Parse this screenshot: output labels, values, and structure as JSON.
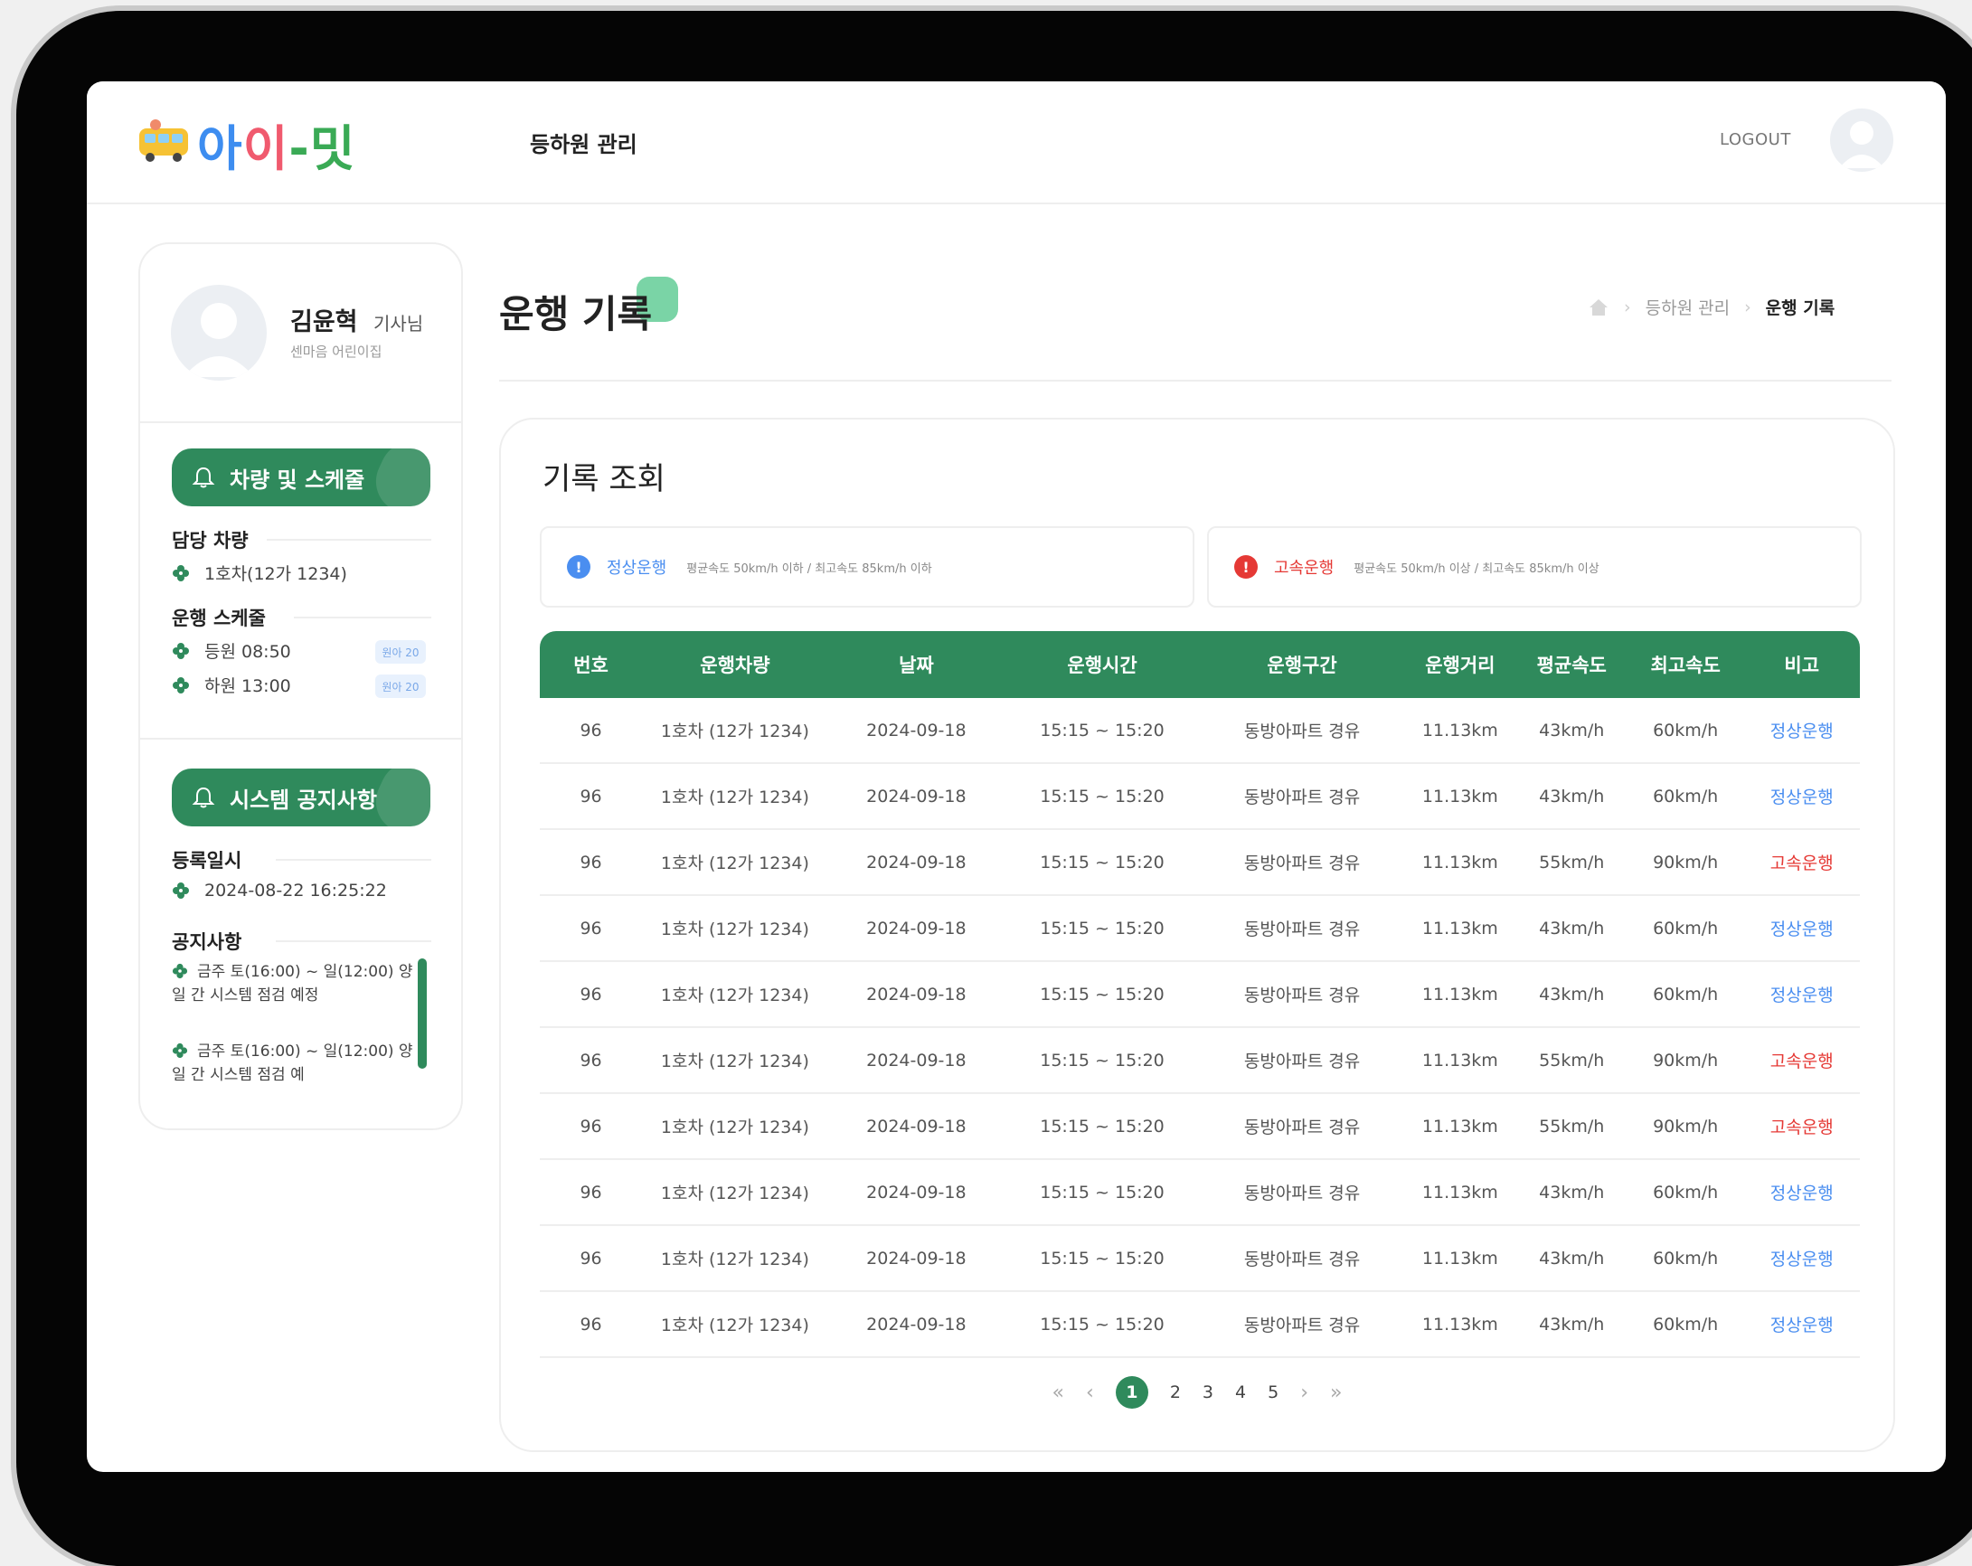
{
  "header": {
    "logo_text": "아이-밋",
    "menu_label": "등하원 관리",
    "logout_label": "LOGOUT",
    "brand_color": "#2f8a5c"
  },
  "profile": {
    "name": "김윤혁",
    "title": "기사님",
    "org": "센마음 어린이집"
  },
  "vehicle_section": {
    "button_label": "차량 및 스케줄",
    "assigned_label": "담당 차량",
    "vehicle": "1호차(12가 1234)",
    "schedule_label": "운행 스케줄",
    "schedule": [
      {
        "label": "등원  08:50",
        "badge": "원아 20"
      },
      {
        "label": "하원  13:00",
        "badge": "원아 20"
      }
    ]
  },
  "notice_section": {
    "button_label": "시스템 공지사항",
    "registered_label": "등록일시",
    "registered_value": "2024-08-22 16:25:22",
    "notice_label": "공지사항",
    "notices": [
      "금주 토(16:00) ~ 일(12:00) 양일 간 시스템 점검 예정",
      "금주 토(16:00) ~ 일(12:00) 양일 간 시스템 점검 예"
    ]
  },
  "page": {
    "title": "운행 기록",
    "breadcrumb": [
      "등하원 관리",
      "운행 기록"
    ]
  },
  "records": {
    "card_title": "기록 조회",
    "legend": {
      "normal_label": "정상운행",
      "normal_desc": "평균속도 50km/h 이하 / 최고속도 85km/h 이하",
      "normal_color": "#4a8ef0",
      "fast_label": "고속운행",
      "fast_desc": "평균속도 50km/h 이상 / 최고속도 85km/h 이상",
      "fast_color": "#e53935"
    },
    "columns": [
      "번호",
      "운행차량",
      "날짜",
      "운행시간",
      "운행구간",
      "운행거리",
      "평균속도",
      "최고속도",
      "비고"
    ],
    "rows": [
      [
        "96",
        "1호차 (12가 1234)",
        "2024-09-18",
        "15:15 ~ 15:20",
        "동방아파트 경유",
        "11.13km",
        "43km/h",
        "60km/h",
        "정상운행"
      ],
      [
        "96",
        "1호차 (12가 1234)",
        "2024-09-18",
        "15:15 ~ 15:20",
        "동방아파트 경유",
        "11.13km",
        "43km/h",
        "60km/h",
        "정상운행"
      ],
      [
        "96",
        "1호차 (12가 1234)",
        "2024-09-18",
        "15:15 ~ 15:20",
        "동방아파트 경유",
        "11.13km",
        "55km/h",
        "90km/h",
        "고속운행"
      ],
      [
        "96",
        "1호차 (12가 1234)",
        "2024-09-18",
        "15:15 ~ 15:20",
        "동방아파트 경유",
        "11.13km",
        "43km/h",
        "60km/h",
        "정상운행"
      ],
      [
        "96",
        "1호차 (12가 1234)",
        "2024-09-18",
        "15:15 ~ 15:20",
        "동방아파트 경유",
        "11.13km",
        "43km/h",
        "60km/h",
        "정상운행"
      ],
      [
        "96",
        "1호차 (12가 1234)",
        "2024-09-18",
        "15:15 ~ 15:20",
        "동방아파트 경유",
        "11.13km",
        "55km/h",
        "90km/h",
        "고속운행"
      ],
      [
        "96",
        "1호차 (12가 1234)",
        "2024-09-18",
        "15:15 ~ 15:20",
        "동방아파트 경유",
        "11.13km",
        "55km/h",
        "90km/h",
        "고속운행"
      ],
      [
        "96",
        "1호차 (12가 1234)",
        "2024-09-18",
        "15:15 ~ 15:20",
        "동방아파트 경유",
        "11.13km",
        "43km/h",
        "60km/h",
        "정상운행"
      ],
      [
        "96",
        "1호차 (12가 1234)",
        "2024-09-18",
        "15:15 ~ 15:20",
        "동방아파트 경유",
        "11.13km",
        "43km/h",
        "60km/h",
        "정상운행"
      ],
      [
        "96",
        "1호차 (12가 1234)",
        "2024-09-18",
        "15:15 ~ 15:20",
        "동방아파트 경유",
        "11.13km",
        "43km/h",
        "60km/h",
        "정상운행"
      ]
    ],
    "pagination": {
      "first": "«",
      "prev": "‹",
      "pages": [
        "1",
        "2",
        "3",
        "4",
        "5"
      ],
      "active_page": "1",
      "next": "›",
      "last": "»"
    }
  }
}
